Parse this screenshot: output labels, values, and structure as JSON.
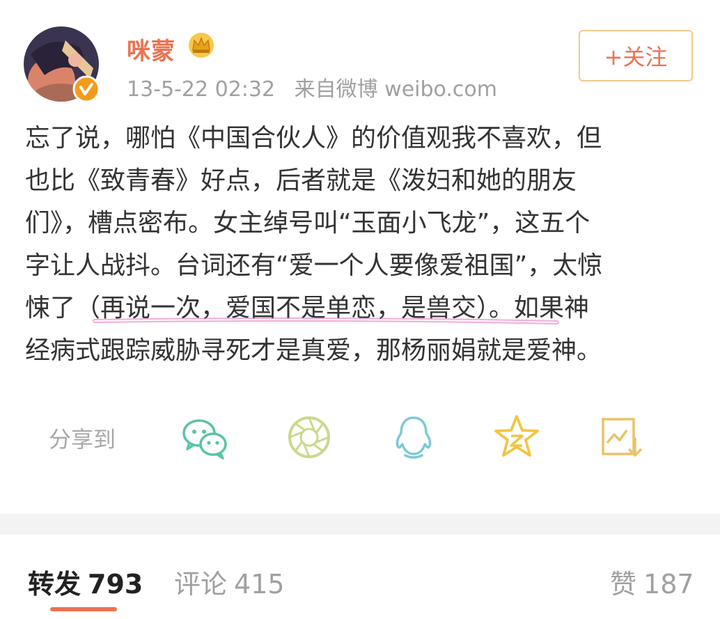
{
  "user": {
    "name": "咪蒙",
    "date": "13-5-22 02:32",
    "source": "来自微博 weibo.com"
  },
  "follow_button": {
    "label": "+关注"
  },
  "post": {
    "lines": [
      "忘了说，哪怕《中国合伙人》的价值观我不喜欢，但",
      "也比《致青春》好点，后者就是《泼妇和她的朋友",
      "们》，槽点密布。女主绰号叫“玉面小飞龙”，这五个",
      "字让人战抖。台词还有“爱一个人要像爱祖国”，太惊",
      "悚了（再说一次，爱国不是单恋，是兽交）。如果神",
      "经病式跟踪威胁寻死才是真爱，那杨丽娟就是爱神。"
    ]
  },
  "share": {
    "label": "分享到",
    "icons": [
      {
        "name": "wechat-icon",
        "color": "#58c3a8"
      },
      {
        "name": "moments-icon",
        "color": "#c9d98a"
      },
      {
        "name": "qq-icon",
        "color": "#7ec9d6"
      },
      {
        "name": "qzone-icon",
        "color": "#f2c542"
      },
      {
        "name": "save-image-icon",
        "color": "#e8c36a"
      }
    ]
  },
  "stats": {
    "repost_label": "转发",
    "repost_count": "793",
    "comment_label": "评论",
    "comment_count": "415",
    "like_label": "赞",
    "like_count": "187"
  },
  "colors": {
    "accent": "#eb7350",
    "follow_border": "#f3c98e",
    "highlight_underline": "#e86ab8"
  }
}
